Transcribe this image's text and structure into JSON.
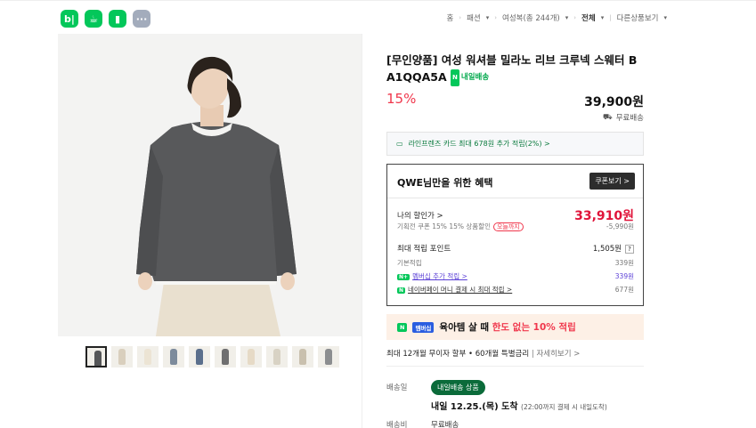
{
  "top_icons": [
    {
      "name": "blog",
      "glyph": "b|"
    },
    {
      "name": "cafe",
      "glyph": "☕"
    },
    {
      "name": "bookmark",
      "glyph": "▮"
    },
    {
      "name": "more",
      "glyph": "···"
    }
  ],
  "breadcrumb": {
    "home": "홈",
    "category": "패션",
    "subcategory": "여성복(총 244개)",
    "filter": "전체",
    "other": "다른상품보기"
  },
  "product": {
    "title": "[무인양품] 여성 워셔블 밀라노 리브 크루넥 스웨터 B A1QQA5A",
    "tag_badge": "N",
    "tag_text": "내일배송",
    "discount": "15%",
    "price": "39,900원",
    "shipping": "무료배송"
  },
  "card_promo": "라인프렌즈 카드 최대 678원 추가 적립(2%) >",
  "benefit": {
    "heading": "QWE님만을 위한 혜택",
    "coupon_button": "쿠폰보기 >",
    "my_discount_label": "나의 할인가 >",
    "my_discount_price": "33,910원",
    "coupon_line": "기획전 쿠폰 15% 15% 상품할인",
    "coupon_pill": "오늘까지",
    "coupon_amount": "-5,990원",
    "max_points_label": "최대 적립 포인트",
    "max_points_value": "1,505원",
    "base_points_label": "기본적립",
    "base_points_value": "339원",
    "membership_label": "멤버십 추가 적립 >",
    "membership_value": "339원",
    "npay_label": "네이버페이 머니 결제 시 최대 적립 >",
    "npay_value": "677원"
  },
  "promo_banner": {
    "badge1": "N",
    "badge2": "멤버십",
    "text_a": "육아템 살 때 ",
    "text_b": "한도 없는 10% 적립"
  },
  "installment": {
    "main": "최대 12개월 무이자 할부 • 60개월 특별금리",
    "link": "자세히보기 >"
  },
  "delivery": {
    "label": "배송일",
    "badge": "내일배송 상품",
    "date": "내일 12.25.(목) 도착",
    "note": "(22:00까지 결제 시 내일도착)",
    "fee_label": "배송비",
    "fee_value": "무료배송"
  },
  "colors": {
    "naver_green": "#03c75a",
    "sale_red": "#f0374c"
  }
}
